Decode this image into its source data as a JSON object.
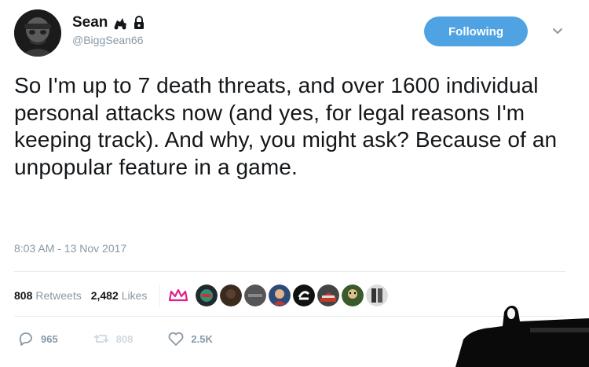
{
  "user": {
    "display_name": "Sean",
    "handle": "@BiggSean66",
    "name_icons": [
      "kart-icon",
      "lock-icon"
    ]
  },
  "follow_button": {
    "label": "Following"
  },
  "tweet": {
    "text": "So I'm up to 7 death threats, and over 1600 individual personal attacks now (and yes, for legal reasons I'm keeping track). And why, you might ask? Because of an unpopular feature in a game.",
    "timestamp": "8:03 AM - 13 Nov 2017"
  },
  "stats": {
    "retweets_count": "808",
    "retweets_label": "Retweets",
    "likes_count": "2,482",
    "likes_label": "Likes"
  },
  "likers": [
    "crown-icon",
    "liker-avatar-1",
    "liker-avatar-2",
    "liker-avatar-3",
    "liker-avatar-4",
    "liker-avatar-5",
    "liker-avatar-6",
    "liker-avatar-7",
    "liker-avatar-8"
  ],
  "actions": {
    "reply_count": "965",
    "retweet_count": "808",
    "like_count": "2.5K"
  },
  "colors": {
    "accent": "#4fa3e3",
    "muted": "#8899a6",
    "text": "#14171a",
    "crown": "#e0218a"
  }
}
